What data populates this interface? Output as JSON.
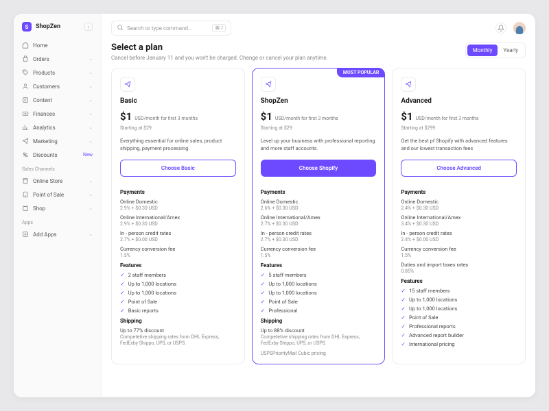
{
  "brand": "ShopZen",
  "search": {
    "placeholder": "Search or type command...",
    "kbd": "⌘ /"
  },
  "nav": {
    "items": [
      {
        "icon": "home",
        "label": "Home",
        "chev": false
      },
      {
        "icon": "orders",
        "label": "Orders",
        "chev": true
      },
      {
        "icon": "products",
        "label": "Products",
        "chev": true
      },
      {
        "icon": "customers",
        "label": "Customers",
        "chev": true
      },
      {
        "icon": "content",
        "label": "Content",
        "chev": true
      },
      {
        "icon": "finances",
        "label": "Finances",
        "chev": true
      },
      {
        "icon": "analytics",
        "label": "Analytics",
        "chev": true
      },
      {
        "icon": "marketing",
        "label": "Marketing",
        "chev": true
      },
      {
        "icon": "discounts",
        "label": "Discounts",
        "badge": "New"
      }
    ],
    "channels_label": "Sales Channels",
    "channels": [
      {
        "icon": "store",
        "label": "Online Store",
        "chev": true
      },
      {
        "icon": "pos",
        "label": "Point of Sale",
        "chev": true
      },
      {
        "icon": "shop",
        "label": "Shop",
        "chev": true
      }
    ],
    "apps_label": "Apps",
    "apps": [
      {
        "icon": "add",
        "label": "Add Apps",
        "chev": true
      }
    ]
  },
  "page": {
    "title": "Select a plan",
    "subtitle": "Cancel before January 11 and you won't be charged. Change or cancel your plan anytime.",
    "toggle": {
      "monthly": "Monthly",
      "yearly": "Yearly"
    }
  },
  "plans": [
    {
      "name": "Basic",
      "price": "$1",
      "price_sub": "USD/month for first 3 months",
      "starting": "Starting at $29",
      "desc": "Everything essential for online sales, product shipping, payment processing.",
      "cta": "Choose Basic",
      "primary": false,
      "payments": [
        {
          "t": "Online Domestic",
          "s": "2.9% + $0.30 USD"
        },
        {
          "t": "Online International/Amex",
          "s": "2.9% + $0.30 USD"
        },
        {
          "t": "In - person credit rates",
          "s": "2.7% + $0.00 USD"
        },
        {
          "t": "Currency conversion fee",
          "s": "1.5%"
        }
      ],
      "features": [
        "2 staff members",
        "Up to 1,000 locations",
        "Up to 1,000 locations",
        "Point of Sale",
        "Basic reports"
      ],
      "shipping": {
        "t": "Up to 77% discount",
        "s": "Competetive shipping rates from DHL Express, FedExby Shippo, UPS, or USPS."
      }
    },
    {
      "popular": "MOST POPULAR",
      "name": "ShopZen",
      "price": "$1",
      "price_sub": "USD/month for first 3 months",
      "starting": "Starting at $29",
      "desc": "Level up your business with professional reporting and more staff accounts.",
      "cta": "Choose Shopify",
      "primary": true,
      "payments": [
        {
          "t": "Online Domestic",
          "s": "2.6% + $0.30 USD"
        },
        {
          "t": "Online International/Amex",
          "s": "2.7% + $0.30 USD"
        },
        {
          "t": "In - person credit rates",
          "s": "2.7% + $0.00 USD"
        },
        {
          "t": "Currency conversion fee",
          "s": "1.5%"
        }
      ],
      "features": [
        "5 staff members",
        "Up to 1,000 locations",
        "Up to 1,000 locations",
        "Point of Sale",
        "Professional"
      ],
      "shipping": {
        "t": "Up to 88% discount",
        "s": "Competetive shipping rates from DHL Express, FedExby Shippo, UPS, or USPS.",
        "extra": "USPSPriorityMail Cubic pricing"
      }
    },
    {
      "name": "Advanced",
      "price": "$1",
      "price_sub": "USD/month for first 3 months",
      "starting": "Starting at $299",
      "desc": "Get the best pf Shopify with advanced features and our lowest transaction fees",
      "cta": "Choose Advanced",
      "primary": false,
      "payments": [
        {
          "t": "Online Domestic",
          "s": "2.4% + $0.30 USD"
        },
        {
          "t": "Online International/Amex",
          "s": "3.4% + $0.30 USD"
        },
        {
          "t": "In - person credit rates",
          "s": "2.4% + $0.00 USD"
        },
        {
          "t": "Currency conversion fee",
          "s": "1.5%"
        },
        {
          "t": "Duties and import taxes rates",
          "s": "0.85%"
        }
      ],
      "features": [
        "15 staff members",
        "Up to 1,000 locations",
        "Up to 1,000 locations",
        "Point of Sale",
        "Professional reports",
        "Advanced report builder",
        "International pricing"
      ]
    }
  ],
  "labels": {
    "payments": "Payments",
    "features": "Features",
    "shipping": "Shipping"
  }
}
